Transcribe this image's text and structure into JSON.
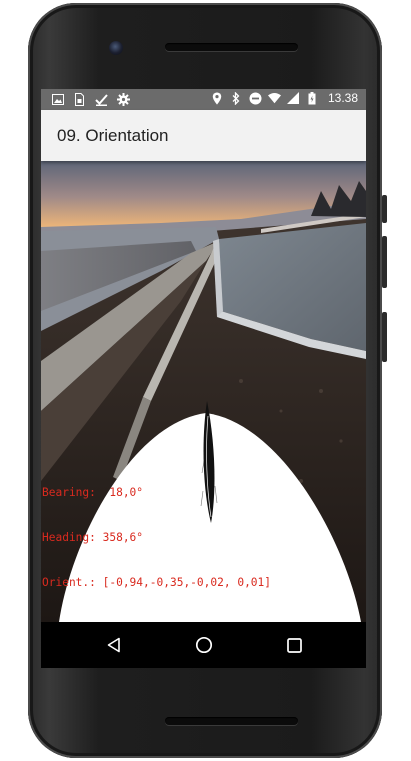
{
  "statusbar": {
    "left_icons": [
      "image-icon",
      "sim-card-icon",
      "check-download-icon",
      "settings-gear-icon"
    ],
    "right_icons": [
      "location-icon",
      "bluetooth-icon",
      "do-not-disturb-icon",
      "wifi-icon",
      "signal-icon",
      "battery-charging-icon"
    ],
    "time": "13.38"
  },
  "appbar": {
    "title": "09. Orientation"
  },
  "camera_view": {
    "overlay_color": "#ffffff",
    "readout": {
      "bearing": "Bearing:  18,0°",
      "heading": "Heading: 358,6°",
      "orient": "Orient.: [-0,94,-0,35,-0,02, 0,01]",
      "color": "#d92a1f"
    }
  },
  "navbar": {
    "back": "back-icon",
    "home": "home-icon",
    "recents": "recents-icon"
  }
}
